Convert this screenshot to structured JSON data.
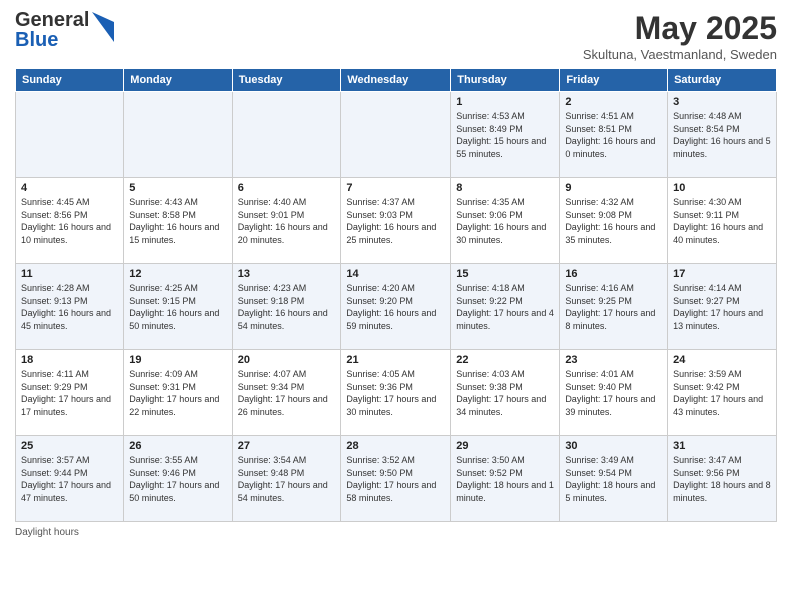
{
  "header": {
    "logo_general": "General",
    "logo_blue": "Blue",
    "month_title": "May 2025",
    "location": "Skultuna, Vaestmanland, Sweden"
  },
  "weekdays": [
    "Sunday",
    "Monday",
    "Tuesday",
    "Wednesday",
    "Thursday",
    "Friday",
    "Saturday"
  ],
  "rows": [
    [
      {
        "day": "",
        "sunrise": "",
        "sunset": "",
        "daylight": ""
      },
      {
        "day": "",
        "sunrise": "",
        "sunset": "",
        "daylight": ""
      },
      {
        "day": "",
        "sunrise": "",
        "sunset": "",
        "daylight": ""
      },
      {
        "day": "",
        "sunrise": "",
        "sunset": "",
        "daylight": ""
      },
      {
        "day": "1",
        "sunrise": "Sunrise: 4:53 AM",
        "sunset": "Sunset: 8:49 PM",
        "daylight": "Daylight: 15 hours and 55 minutes."
      },
      {
        "day": "2",
        "sunrise": "Sunrise: 4:51 AM",
        "sunset": "Sunset: 8:51 PM",
        "daylight": "Daylight: 16 hours and 0 minutes."
      },
      {
        "day": "3",
        "sunrise": "Sunrise: 4:48 AM",
        "sunset": "Sunset: 8:54 PM",
        "daylight": "Daylight: 16 hours and 5 minutes."
      }
    ],
    [
      {
        "day": "4",
        "sunrise": "Sunrise: 4:45 AM",
        "sunset": "Sunset: 8:56 PM",
        "daylight": "Daylight: 16 hours and 10 minutes."
      },
      {
        "day": "5",
        "sunrise": "Sunrise: 4:43 AM",
        "sunset": "Sunset: 8:58 PM",
        "daylight": "Daylight: 16 hours and 15 minutes."
      },
      {
        "day": "6",
        "sunrise": "Sunrise: 4:40 AM",
        "sunset": "Sunset: 9:01 PM",
        "daylight": "Daylight: 16 hours and 20 minutes."
      },
      {
        "day": "7",
        "sunrise": "Sunrise: 4:37 AM",
        "sunset": "Sunset: 9:03 PM",
        "daylight": "Daylight: 16 hours and 25 minutes."
      },
      {
        "day": "8",
        "sunrise": "Sunrise: 4:35 AM",
        "sunset": "Sunset: 9:06 PM",
        "daylight": "Daylight: 16 hours and 30 minutes."
      },
      {
        "day": "9",
        "sunrise": "Sunrise: 4:32 AM",
        "sunset": "Sunset: 9:08 PM",
        "daylight": "Daylight: 16 hours and 35 minutes."
      },
      {
        "day": "10",
        "sunrise": "Sunrise: 4:30 AM",
        "sunset": "Sunset: 9:11 PM",
        "daylight": "Daylight: 16 hours and 40 minutes."
      }
    ],
    [
      {
        "day": "11",
        "sunrise": "Sunrise: 4:28 AM",
        "sunset": "Sunset: 9:13 PM",
        "daylight": "Daylight: 16 hours and 45 minutes."
      },
      {
        "day": "12",
        "sunrise": "Sunrise: 4:25 AM",
        "sunset": "Sunset: 9:15 PM",
        "daylight": "Daylight: 16 hours and 50 minutes."
      },
      {
        "day": "13",
        "sunrise": "Sunrise: 4:23 AM",
        "sunset": "Sunset: 9:18 PM",
        "daylight": "Daylight: 16 hours and 54 minutes."
      },
      {
        "day": "14",
        "sunrise": "Sunrise: 4:20 AM",
        "sunset": "Sunset: 9:20 PM",
        "daylight": "Daylight: 16 hours and 59 minutes."
      },
      {
        "day": "15",
        "sunrise": "Sunrise: 4:18 AM",
        "sunset": "Sunset: 9:22 PM",
        "daylight": "Daylight: 17 hours and 4 minutes."
      },
      {
        "day": "16",
        "sunrise": "Sunrise: 4:16 AM",
        "sunset": "Sunset: 9:25 PM",
        "daylight": "Daylight: 17 hours and 8 minutes."
      },
      {
        "day": "17",
        "sunrise": "Sunrise: 4:14 AM",
        "sunset": "Sunset: 9:27 PM",
        "daylight": "Daylight: 17 hours and 13 minutes."
      }
    ],
    [
      {
        "day": "18",
        "sunrise": "Sunrise: 4:11 AM",
        "sunset": "Sunset: 9:29 PM",
        "daylight": "Daylight: 17 hours and 17 minutes."
      },
      {
        "day": "19",
        "sunrise": "Sunrise: 4:09 AM",
        "sunset": "Sunset: 9:31 PM",
        "daylight": "Daylight: 17 hours and 22 minutes."
      },
      {
        "day": "20",
        "sunrise": "Sunrise: 4:07 AM",
        "sunset": "Sunset: 9:34 PM",
        "daylight": "Daylight: 17 hours and 26 minutes."
      },
      {
        "day": "21",
        "sunrise": "Sunrise: 4:05 AM",
        "sunset": "Sunset: 9:36 PM",
        "daylight": "Daylight: 17 hours and 30 minutes."
      },
      {
        "day": "22",
        "sunrise": "Sunrise: 4:03 AM",
        "sunset": "Sunset: 9:38 PM",
        "daylight": "Daylight: 17 hours and 34 minutes."
      },
      {
        "day": "23",
        "sunrise": "Sunrise: 4:01 AM",
        "sunset": "Sunset: 9:40 PM",
        "daylight": "Daylight: 17 hours and 39 minutes."
      },
      {
        "day": "24",
        "sunrise": "Sunrise: 3:59 AM",
        "sunset": "Sunset: 9:42 PM",
        "daylight": "Daylight: 17 hours and 43 minutes."
      }
    ],
    [
      {
        "day": "25",
        "sunrise": "Sunrise: 3:57 AM",
        "sunset": "Sunset: 9:44 PM",
        "daylight": "Daylight: 17 hours and 47 minutes."
      },
      {
        "day": "26",
        "sunrise": "Sunrise: 3:55 AM",
        "sunset": "Sunset: 9:46 PM",
        "daylight": "Daylight: 17 hours and 50 minutes."
      },
      {
        "day": "27",
        "sunrise": "Sunrise: 3:54 AM",
        "sunset": "Sunset: 9:48 PM",
        "daylight": "Daylight: 17 hours and 54 minutes."
      },
      {
        "day": "28",
        "sunrise": "Sunrise: 3:52 AM",
        "sunset": "Sunset: 9:50 PM",
        "daylight": "Daylight: 17 hours and 58 minutes."
      },
      {
        "day": "29",
        "sunrise": "Sunrise: 3:50 AM",
        "sunset": "Sunset: 9:52 PM",
        "daylight": "Daylight: 18 hours and 1 minute."
      },
      {
        "day": "30",
        "sunrise": "Sunrise: 3:49 AM",
        "sunset": "Sunset: 9:54 PM",
        "daylight": "Daylight: 18 hours and 5 minutes."
      },
      {
        "day": "31",
        "sunrise": "Sunrise: 3:47 AM",
        "sunset": "Sunset: 9:56 PM",
        "daylight": "Daylight: 18 hours and 8 minutes."
      }
    ]
  ],
  "footer": {
    "daylight_hours": "Daylight hours"
  }
}
